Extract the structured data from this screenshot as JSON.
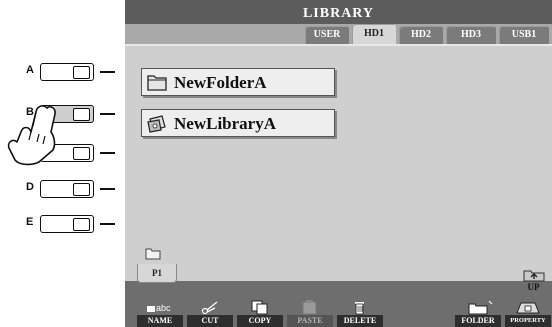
{
  "side_buttons": [
    {
      "letter": "A"
    },
    {
      "letter": "B"
    },
    {
      "letter": ""
    },
    {
      "letter": "D"
    },
    {
      "letter": "E"
    }
  ],
  "screen": {
    "title": "LIBRARY",
    "tabs": [
      {
        "label": "USER"
      },
      {
        "label": "HD1"
      },
      {
        "label": "HD2"
      },
      {
        "label": "HD3"
      },
      {
        "label": "USB1"
      }
    ],
    "active_tab": "HD1",
    "items": [
      {
        "label": "NewFolderA",
        "icon": "folder-icon"
      },
      {
        "label": "NewLibraryA",
        "icon": "library-icon"
      }
    ],
    "page_tab": "P1",
    "up_label": "UP",
    "functions": [
      {
        "label": "NAME",
        "icon_text": "abc"
      },
      {
        "label": "CUT"
      },
      {
        "label": "COPY"
      },
      {
        "label": "PASTE"
      },
      {
        "label": "DELETE"
      },
      {
        "label": "FOLDER"
      },
      {
        "label": "PROPERTY"
      }
    ]
  }
}
